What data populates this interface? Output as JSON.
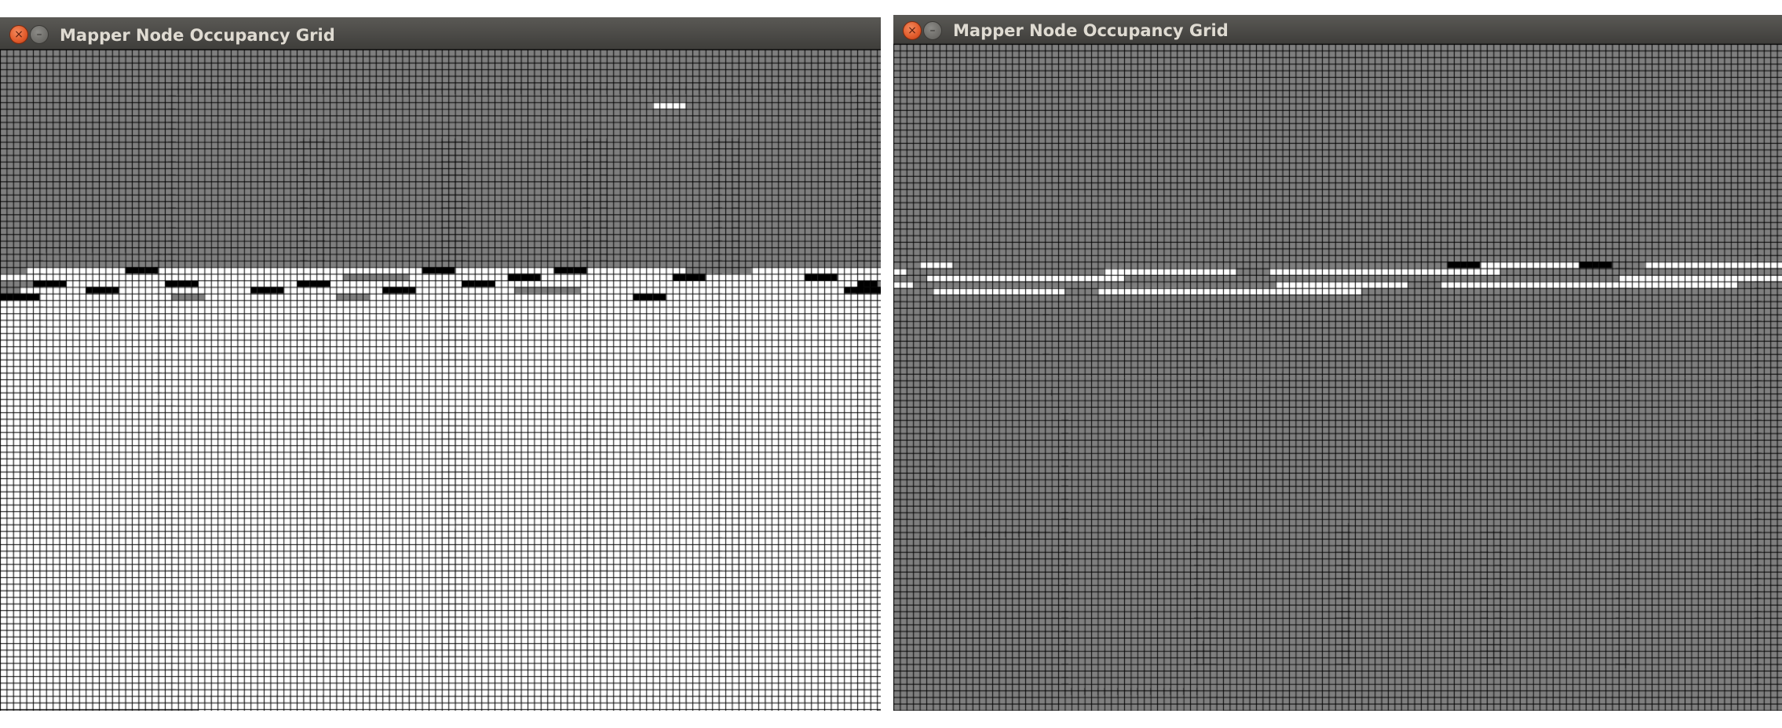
{
  "windows": [
    {
      "title": "Mapper Node Occupancy Grid",
      "close_icon": "close-icon",
      "minimize_icon": "minimize-icon"
    },
    {
      "title": "Mapper Node Occupancy Grid",
      "close_icon": "close-icon",
      "minimize_icon": "minimize-icon"
    }
  ],
  "legend_colors": {
    "unknown": "#7f7f7f",
    "free": "#ffffff",
    "occupied": "#000000",
    "grid_line": "#000000"
  }
}
